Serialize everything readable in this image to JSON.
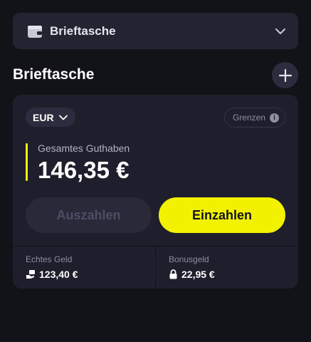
{
  "wallet_select": {
    "label": "Brieftasche"
  },
  "section": {
    "title": "Brieftasche"
  },
  "card": {
    "currency": "EUR",
    "limits_label": "Grenzen",
    "balance_label": "Gesamtes Guthaben",
    "balance_value": "146,35 €",
    "withdraw_label": "Auszahlen",
    "deposit_label": "Einzahlen",
    "real_money_label": "Echtes Geld",
    "real_money_value": "123,40 €",
    "bonus_label": "Bonusgeld",
    "bonus_value": "22,95 €"
  },
  "colors": {
    "accent": "#f2f200",
    "background": "#121219",
    "card": "#1e1e2c"
  },
  "icons": [
    "wallet-icon",
    "chevron-down-icon",
    "plus-icon",
    "info-icon",
    "cash-hand-icon",
    "lock-icon"
  ]
}
